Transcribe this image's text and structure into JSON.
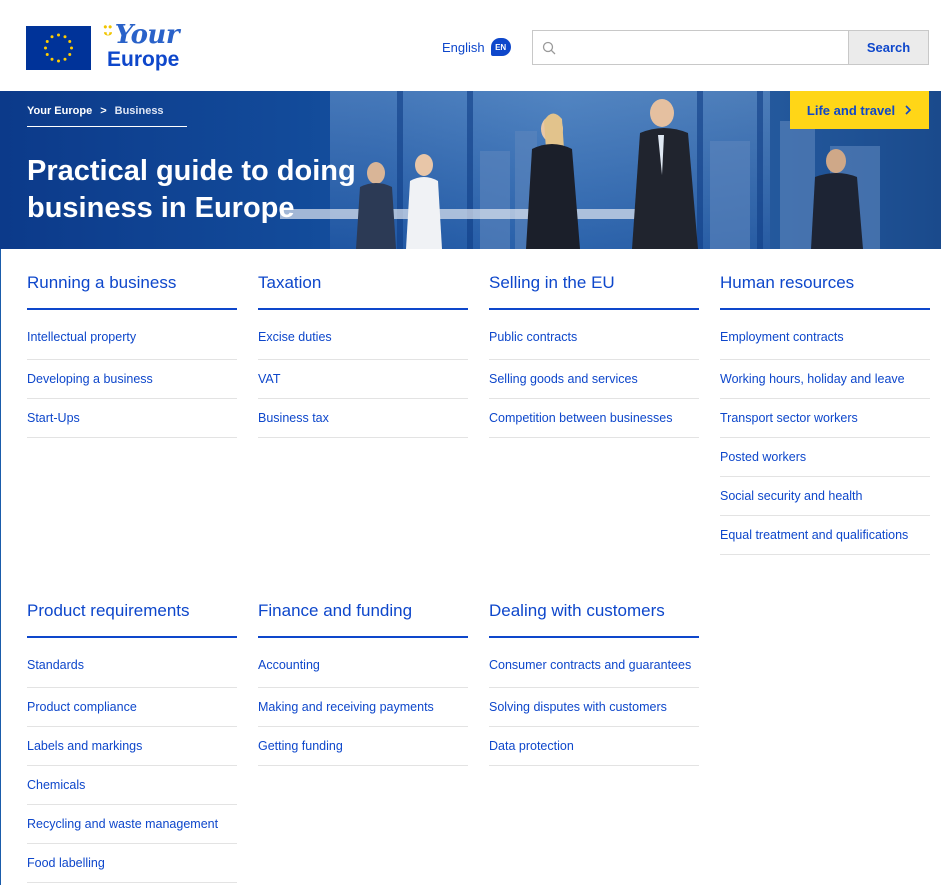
{
  "header": {
    "brand_your": "Your",
    "brand_europe": "Europe",
    "language_label": "English",
    "language_code": "EN",
    "search_placeholder": "",
    "search_button": "Search"
  },
  "hero": {
    "breadcrumb": [
      "Your Europe",
      ">",
      "Business"
    ],
    "title": "Practical guide to doing business in Europe",
    "life_button": "Life and travel",
    "life_button_icon": "chevron-right-icon"
  },
  "colors": {
    "brand_blue": "#0e47cb",
    "accent_yellow": "#ffd617",
    "hero_blue": "#144f9e"
  },
  "sections": [
    {
      "title": "Running a business",
      "items": [
        "Intellectual property",
        "Developing a business",
        "Start-Ups"
      ]
    },
    {
      "title": "Taxation",
      "items": [
        "Excise duties",
        "VAT",
        "Business tax"
      ]
    },
    {
      "title": "Selling in the EU",
      "items": [
        "Public contracts",
        "Selling goods and services",
        "Competition between businesses"
      ]
    },
    {
      "title": "Human resources",
      "items": [
        "Employment contracts",
        "Working hours, holiday and leave",
        "Transport sector workers",
        "Posted workers",
        "Social security and health",
        "Equal treatment and qualifications"
      ]
    },
    {
      "title": "Product requirements",
      "items": [
        "Standards",
        "Product compliance",
        "Labels and markings",
        "Chemicals",
        "Recycling and waste management",
        "Food labelling"
      ]
    },
    {
      "title": "Finance and funding",
      "items": [
        "Accounting",
        "Making and receiving payments",
        "Getting funding"
      ]
    },
    {
      "title": "Dealing with customers",
      "items": [
        "Consumer contracts and guarantees",
        "Solving disputes with customers",
        "Data protection"
      ]
    }
  ]
}
